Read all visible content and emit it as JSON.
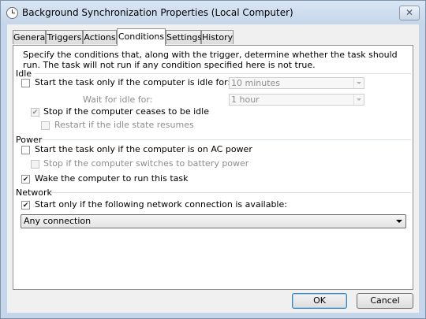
{
  "window": {
    "title": "Background Synchronization Properties (Local Computer)",
    "close_glyph": "✕",
    "icon": "clock-icon"
  },
  "tabs": [
    {
      "label": "General"
    },
    {
      "label": "Triggers"
    },
    {
      "label": "Actions"
    },
    {
      "label": "Conditions",
      "active": true
    },
    {
      "label": "Settings"
    },
    {
      "label": "History"
    }
  ],
  "conditions": {
    "description": "Specify the conditions that, along with the trigger, determine whether the task should run.  The task will not run  if any condition specified here is not true.",
    "idle": {
      "group_title": "Idle",
      "start_if_idle": {
        "label": "Start the task only if the computer is idle for:",
        "checked": false
      },
      "idle_duration": {
        "value": "10 minutes"
      },
      "wait_label": "Wait for idle for:",
      "wait_duration": {
        "value": "1 hour"
      },
      "stop_if_not_idle": {
        "label": "Stop if the computer ceases to be idle",
        "checked": true
      },
      "restart_if_idle": {
        "label": "Restart if the idle state resumes",
        "checked": false
      }
    },
    "power": {
      "group_title": "Power",
      "start_on_ac": {
        "label": "Start the task only if the computer is on AC power",
        "checked": false
      },
      "stop_on_battery": {
        "label": "Stop if the computer switches to battery power",
        "checked": false
      },
      "wake_to_run": {
        "label": "Wake the computer to run this task",
        "checked": true
      }
    },
    "network": {
      "group_title": "Network",
      "start_if_network": {
        "label": "Start only if the following network connection is available:",
        "checked": true
      },
      "connection": {
        "value": "Any connection"
      }
    }
  },
  "buttons": {
    "ok": "OK",
    "cancel": "Cancel"
  },
  "colors": {
    "title_bar": "#c5d6ea",
    "dialog_bg": "#f0f0f0",
    "default_button_border": "#3c7fb1"
  }
}
